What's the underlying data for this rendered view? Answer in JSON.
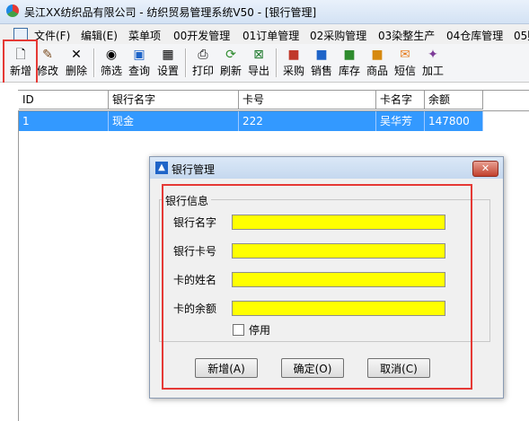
{
  "window": {
    "title": "吴江XX纺织品有限公司 - 纺织贸易管理系统V50 - [银行管理]"
  },
  "menu": {
    "items": [
      "文件(F)",
      "编辑(E)",
      "菜单项",
      "00开发管理",
      "01订单管理",
      "02采购管理",
      "03染整生产",
      "04仓库管理",
      "05财"
    ]
  },
  "toolbar": {
    "buttons": [
      {
        "label": "新增",
        "icon": "new-file-icon"
      },
      {
        "label": "修改",
        "icon": "edit-brush-icon"
      },
      {
        "label": "删除",
        "icon": "delete-x-icon"
      },
      {
        "label": "筛选",
        "icon": "binoculars-icon"
      },
      {
        "label": "查询",
        "icon": "query-icon"
      },
      {
        "label": "设置",
        "icon": "settings-grid-icon"
      },
      {
        "label": "打印",
        "icon": "printer-icon"
      },
      {
        "label": "刷新",
        "icon": "refresh-icon"
      },
      {
        "label": "导出",
        "icon": "export-excel-icon"
      },
      {
        "label": "采购",
        "icon": "purchase-icon"
      },
      {
        "label": "销售",
        "icon": "sales-icon"
      },
      {
        "label": "库存",
        "icon": "inventory-icon"
      },
      {
        "label": "商品",
        "icon": "product-icon"
      },
      {
        "label": "短信",
        "icon": "sms-icon"
      },
      {
        "label": "加工",
        "icon": "processing-icon"
      }
    ]
  },
  "grid": {
    "columns": [
      "ID",
      "银行名字",
      "卡号",
      "卡名字",
      "余额"
    ],
    "rows": [
      [
        "1",
        "现金",
        "222",
        "吴华芳",
        "147800"
      ]
    ]
  },
  "dialog": {
    "title": "银行管理",
    "close_label": "✕",
    "group_label": "银行信息",
    "fields": [
      {
        "label": "银行名字",
        "value": ""
      },
      {
        "label": "银行卡号",
        "value": ""
      },
      {
        "label": "卡的姓名",
        "value": ""
      },
      {
        "label": "卡的余额",
        "value": ""
      }
    ],
    "checkbox_label": "停用",
    "buttons": {
      "add": "新增(A)",
      "ok": "确定(O)",
      "cancel": "取消(C)"
    }
  },
  "colors": {
    "selection": "#3399ff",
    "input_bg": "#ffff00",
    "highlight_frame": "#e53935"
  }
}
